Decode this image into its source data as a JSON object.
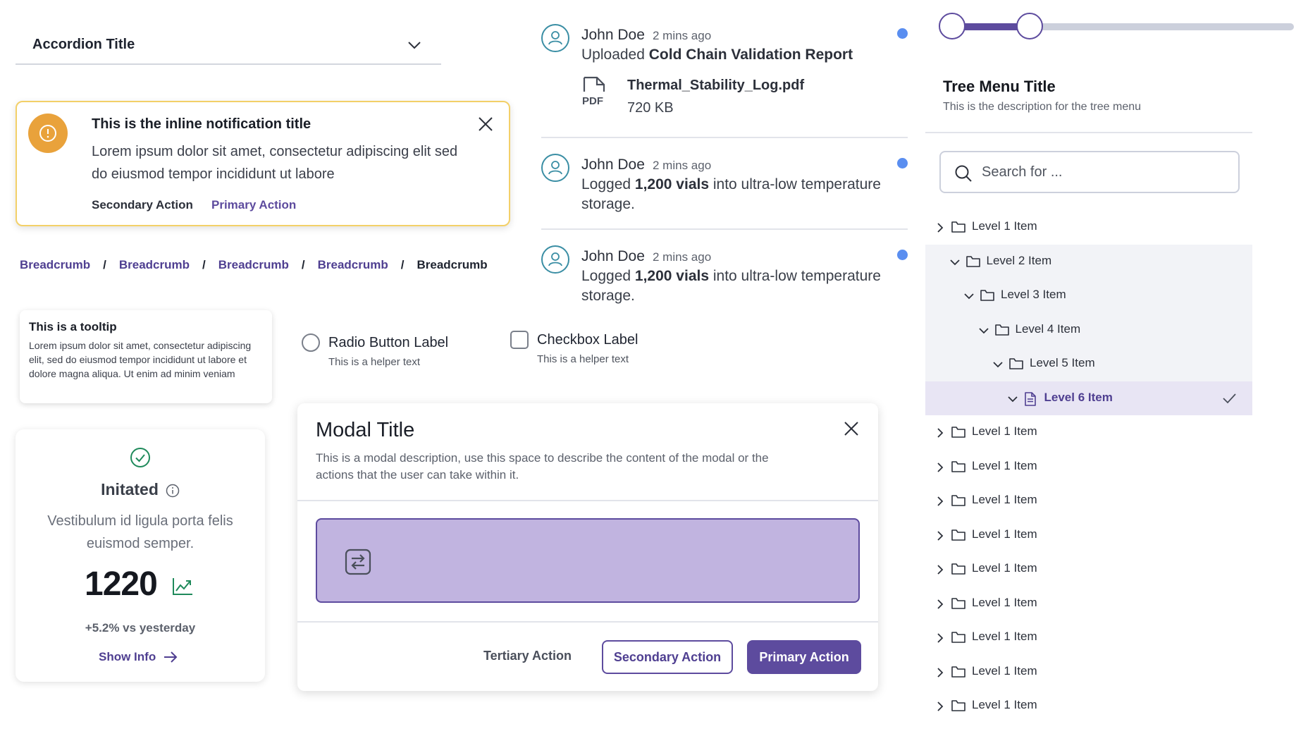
{
  "accordion": {
    "title": "Accordion Title"
  },
  "notification": {
    "title": "This is the inline notification title",
    "body": "Lorem ipsum dolor sit amet, consectetur adipiscing elit sed do eiusmod tempor incididunt ut labore",
    "secondary_action": "Secondary Action",
    "primary_action": "Primary Action",
    "icon": "warning-icon",
    "accent_color": "#e9a23b"
  },
  "breadcrumb": {
    "items": [
      "Breadcrumb",
      "Breadcrumb",
      "Breadcrumb",
      "Breadcrumb",
      "Breadcrumb"
    ],
    "separator": "/"
  },
  "tooltip": {
    "title": "This is a tooltip",
    "body": "Lorem ipsum dolor sit amet, consectetur adipiscing elit, sed do eiusmod tempor incididunt ut labore et dolore magna aliqua. Ut enim ad minim veniam"
  },
  "stat_card": {
    "status": "Initated",
    "description": "Vestibulum id ligula porta felis euismod semper.",
    "value": "1220",
    "delta": "+5.2% vs yesterday",
    "link": "Show Info",
    "status_color": "#1f8a5b"
  },
  "radio": {
    "label": "Radio Button Label",
    "helper": "This is a helper text",
    "checked": false
  },
  "checkbox": {
    "label": "Checkbox Label",
    "helper": "This is a helper text",
    "checked": false
  },
  "modal": {
    "title": "Modal Title",
    "description": "This is a modal description, use this space to describe the content of the modal or the actions that the user can take within it.",
    "slot_icon": "swap-icon",
    "tertiary_action": "Tertiary Action",
    "secondary_action": "Secondary Action",
    "primary_action": "Primary Action",
    "brand_color": "#5d4b9e"
  },
  "feed": [
    {
      "user": "John Doe",
      "time": "2 mins ago",
      "action": "Uploaded",
      "subject": "Cold Chain Validation Report",
      "file": {
        "name": "Thermal_Stability_Log.pdf",
        "size": "720 KB",
        "icon": "pdf-icon"
      },
      "unread": true
    },
    {
      "user": "John Doe",
      "time": "2 mins ago",
      "action": "Logged",
      "subject": "1,200 vials",
      "rest": "into ultra-low temperature storage.",
      "unread": true
    },
    {
      "user": "John Doe",
      "time": "2 mins ago",
      "action": "Logged",
      "subject": "1,200 vials",
      "rest": "into ultra-low temperature storage.",
      "unread": true
    }
  ],
  "slider": {
    "low": 0.03,
    "high": 0.25
  },
  "tree": {
    "title": "Tree Menu Title",
    "description": "This is the description for the tree menu",
    "search_placeholder": "Search for ...",
    "nodes": [
      {
        "label": "Level 1 Item",
        "level": 1,
        "expanded": false,
        "type": "folder"
      },
      {
        "label": "Level 2 Item",
        "level": 2,
        "expanded": true,
        "type": "folder"
      },
      {
        "label": "Level 3 Item",
        "level": 3,
        "expanded": true,
        "type": "folder"
      },
      {
        "label": "Level 4 Item",
        "level": 4,
        "expanded": true,
        "type": "folder"
      },
      {
        "label": "Level 5 Item",
        "level": 5,
        "expanded": true,
        "type": "folder"
      },
      {
        "label": "Level 6 Item",
        "level": 6,
        "expanded": true,
        "type": "file",
        "selected": true
      },
      {
        "label": "Level 1 Item",
        "level": 1,
        "expanded": false,
        "type": "folder"
      },
      {
        "label": "Level 1 Item",
        "level": 1,
        "expanded": false,
        "type": "folder"
      },
      {
        "label": "Level 1 Item",
        "level": 1,
        "expanded": false,
        "type": "folder"
      },
      {
        "label": "Level 1 Item",
        "level": 1,
        "expanded": false,
        "type": "folder"
      },
      {
        "label": "Level 1 Item",
        "level": 1,
        "expanded": false,
        "type": "folder"
      },
      {
        "label": "Level 1 Item",
        "level": 1,
        "expanded": false,
        "type": "folder"
      },
      {
        "label": "Level 1 Item",
        "level": 1,
        "expanded": false,
        "type": "folder"
      },
      {
        "label": "Level 1 Item",
        "level": 1,
        "expanded": false,
        "type": "folder"
      },
      {
        "label": "Level 1 Item",
        "level": 1,
        "expanded": false,
        "type": "folder"
      }
    ]
  }
}
